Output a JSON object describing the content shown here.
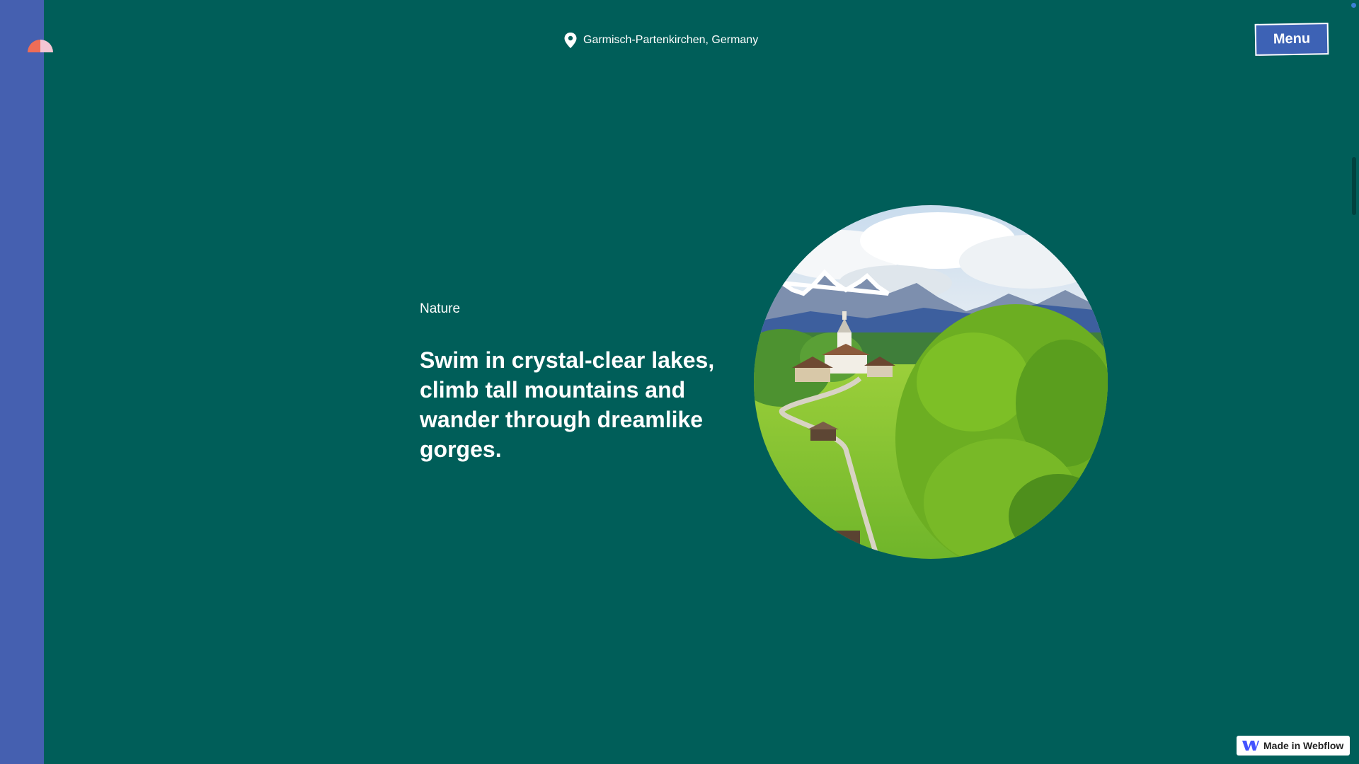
{
  "header": {
    "location": "Garmisch-Partenkirchen, Germany",
    "location_icon": "map-pin-icon",
    "menu_label": "Menu",
    "logo_icon": "half-circle-logo-icon"
  },
  "hero": {
    "category": "Nature",
    "headline": "Swim in crystal-clear lakes, climb tall mountains and wander through dreamlike gorges.",
    "image_subject": "alpine-village-landscape-photo"
  },
  "badge": {
    "label": "Made in Webflow",
    "icon": "webflow-logo-icon"
  },
  "colors": {
    "background": "#005e59",
    "side_strip": "#4560b0",
    "menu_button": "#3d62b5",
    "text": "#ffffff"
  }
}
